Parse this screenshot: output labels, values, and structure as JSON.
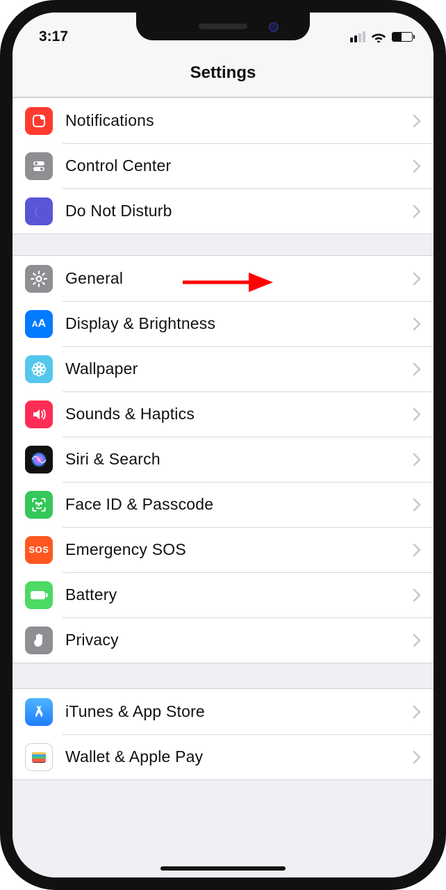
{
  "status": {
    "time": "3:17"
  },
  "header": {
    "title": "Settings"
  },
  "groups": [
    {
      "rows": [
        {
          "id": "notifications",
          "label": "Notifications",
          "icon": "notifications-icon",
          "color": "#ff3b30"
        },
        {
          "id": "control-center",
          "label": "Control Center",
          "icon": "toggles-icon",
          "color": "#8e8e93"
        },
        {
          "id": "do-not-disturb",
          "label": "Do Not Disturb",
          "icon": "moon-icon",
          "color": "#5856d6"
        }
      ]
    },
    {
      "rows": [
        {
          "id": "general",
          "label": "General",
          "icon": "gear-icon",
          "color": "#8e8e93",
          "highlight": true
        },
        {
          "id": "display-brightness",
          "label": "Display & Brightness",
          "icon": "text-size-icon",
          "color": "#007aff"
        },
        {
          "id": "wallpaper",
          "label": "Wallpaper",
          "icon": "flower-icon",
          "color": "#54c7ec"
        },
        {
          "id": "sounds-haptics",
          "label": "Sounds & Haptics",
          "icon": "speaker-icon",
          "color": "#ff2d55"
        },
        {
          "id": "siri-search",
          "label": "Siri & Search",
          "icon": "siri-icon",
          "color": "#111111"
        },
        {
          "id": "face-id-passcode",
          "label": "Face ID & Passcode",
          "icon": "face-id-icon",
          "color": "#34c759"
        },
        {
          "id": "emergency-sos",
          "label": "Emergency SOS",
          "icon": "sos-icon",
          "color": "#ff5722"
        },
        {
          "id": "battery",
          "label": "Battery",
          "icon": "battery-icon",
          "color": "#4cd964"
        },
        {
          "id": "privacy",
          "label": "Privacy",
          "icon": "hand-icon",
          "color": "#8e8e93"
        }
      ]
    },
    {
      "rows": [
        {
          "id": "itunes-app-store",
          "label": "iTunes & App Store",
          "icon": "appstore-icon",
          "color": "#1e90ff"
        },
        {
          "id": "wallet-apple-pay",
          "label": "Wallet & Apple Pay",
          "icon": "wallet-icon",
          "color": "#111111"
        }
      ]
    }
  ],
  "annotation": {
    "target": "general",
    "type": "arrow"
  }
}
